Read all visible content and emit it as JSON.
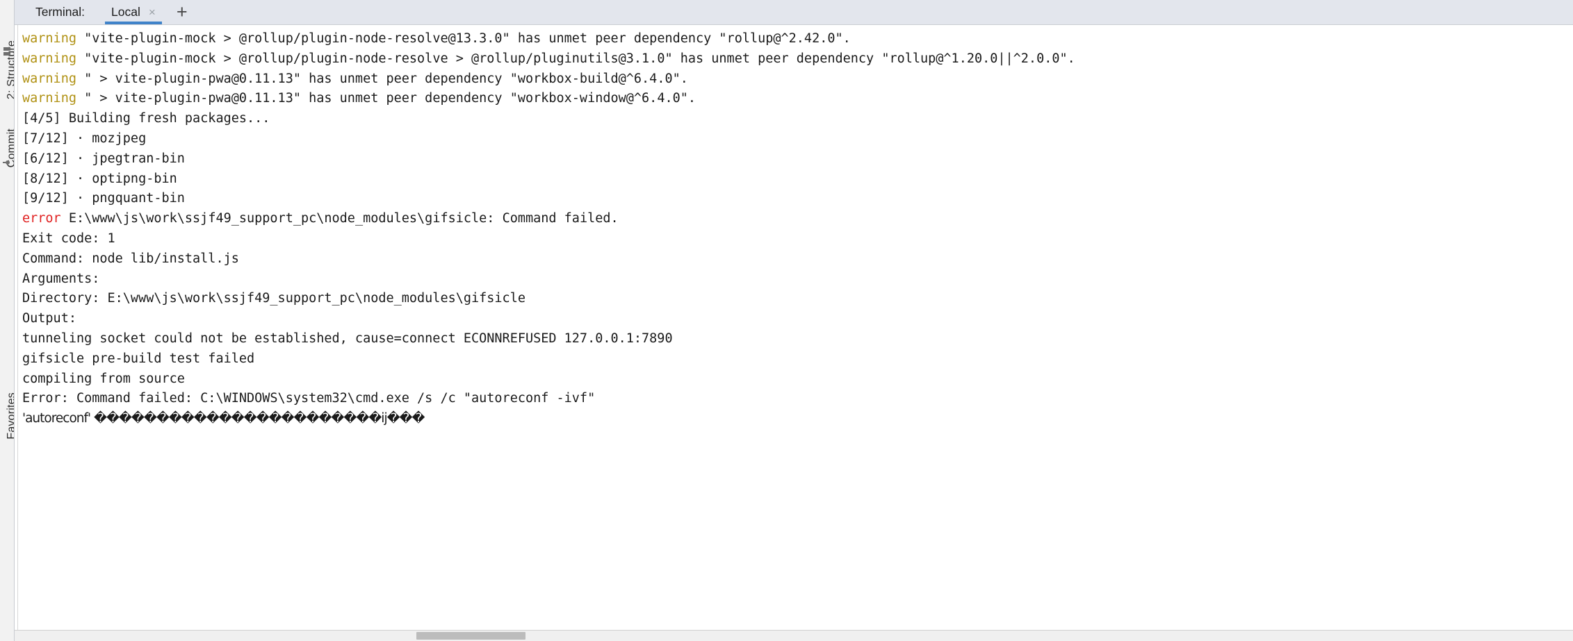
{
  "tool_stripe": {
    "items": [
      {
        "label": "2: Structure",
        "icon": "structure-icon"
      },
      {
        "label": "Commit",
        "icon": "commit-branch-icon"
      },
      {
        "label": "Favorites",
        "icon": "favorites-icon"
      }
    ]
  },
  "header": {
    "title": "Terminal:",
    "tabs": [
      {
        "label": "Local",
        "active": true,
        "close_glyph": "×"
      }
    ],
    "add_tab_glyph": "+"
  },
  "terminal": {
    "lines": [
      {
        "tag": "warning",
        "tag_text": "warning",
        "text": " \"vite-plugin-mock > @rollup/plugin-node-resolve@13.3.0\" has unmet peer dependency \"rollup@^2.42.0\"."
      },
      {
        "tag": "warning",
        "tag_text": "warning",
        "text": " \"vite-plugin-mock > @rollup/plugin-node-resolve > @rollup/pluginutils@3.1.0\" has unmet peer dependency \"rollup@^1.20.0||^2.0.0\"."
      },
      {
        "tag": "warning",
        "tag_text": "warning",
        "text": " \" > vite-plugin-pwa@0.11.13\" has unmet peer dependency \"workbox-build@^6.4.0\"."
      },
      {
        "tag": "warning",
        "tag_text": "warning",
        "text": " \" > vite-plugin-pwa@0.11.13\" has unmet peer dependency \"workbox-window@^6.4.0\"."
      },
      {
        "tag": "plain",
        "tag_text": "",
        "text": "[4/5] Building fresh packages..."
      },
      {
        "tag": "plain",
        "tag_text": "",
        "text": "[7/12] · mozjpeg"
      },
      {
        "tag": "plain",
        "tag_text": "",
        "text": "[6/12] · jpegtran-bin"
      },
      {
        "tag": "plain",
        "tag_text": "",
        "text": "[8/12] · optipng-bin"
      },
      {
        "tag": "plain",
        "tag_text": "",
        "text": "[9/12] · pngquant-bin"
      },
      {
        "tag": "error",
        "tag_text": "error",
        "text": " E:\\www\\js\\work\\ssjf49_support_pc\\node_modules\\gifsicle: Command failed."
      },
      {
        "tag": "plain",
        "tag_text": "",
        "text": "Exit code: 1"
      },
      {
        "tag": "plain",
        "tag_text": "",
        "text": "Command: node lib/install.js"
      },
      {
        "tag": "plain",
        "tag_text": "",
        "text": "Arguments:"
      },
      {
        "tag": "plain",
        "tag_text": "",
        "text": "Directory: E:\\www\\js\\work\\ssjf49_support_pc\\node_modules\\gifsicle"
      },
      {
        "tag": "plain",
        "tag_text": "",
        "text": "Output:"
      },
      {
        "tag": "plain",
        "tag_text": "",
        "text": "tunneling socket could not be established, cause=connect ECONNREFUSED 127.0.0.1:7890"
      },
      {
        "tag": "plain",
        "tag_text": "",
        "text": "gifsicle pre-build test failed"
      },
      {
        "tag": "plain",
        "tag_text": "",
        "text": "compiling from source"
      },
      {
        "tag": "plain",
        "tag_text": "",
        "text": "Error: Command failed: C:\\WINDOWS\\system32\\cmd.exe /s /c \"autoreconf -ivf\""
      },
      {
        "tag": "mojibake",
        "tag_text": "",
        "text": "'autoreconf' �����������������������ij���"
      }
    ]
  },
  "colors": {
    "warning": "#b09113",
    "error": "#e02020",
    "tab_accent": "#4083c9",
    "tabbar_bg": "#e3e6ed",
    "terminal_bg": "#ffffff",
    "text": "#1a1a1a"
  },
  "scrollbar": {
    "orientation": "horizontal",
    "thumb_left_pct": 25.8,
    "thumb_width_pct": 7.0
  }
}
